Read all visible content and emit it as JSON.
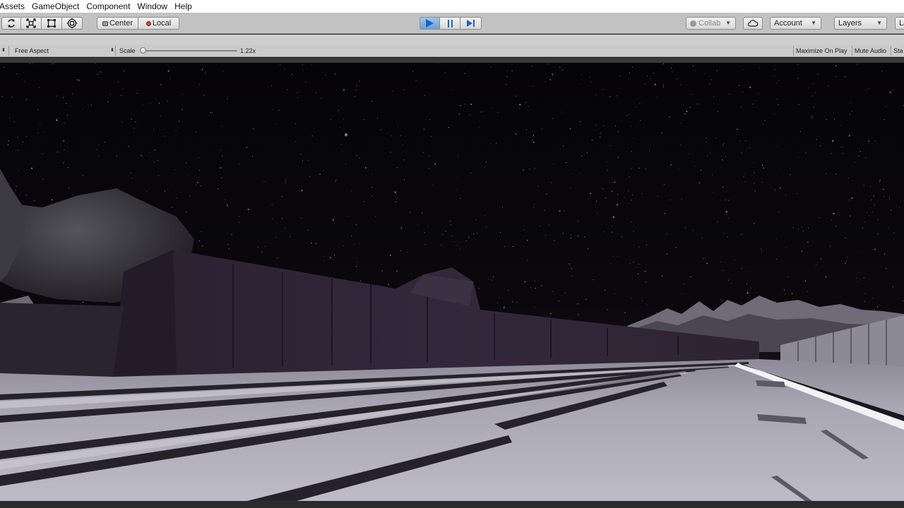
{
  "menubar": {
    "items": [
      "Assets",
      "GameObject",
      "Component",
      "Window",
      "Help"
    ]
  },
  "toolbar": {
    "pivot_center_label": "Center",
    "pivot_local_label": "Local",
    "collab_label": "Collab",
    "account_label": "Account",
    "layers_label": "Layers",
    "layout_label": "La",
    "accent_color": "#1b63c6"
  },
  "game_view": {
    "aspect_label": "Free Aspect",
    "scale_label": "Scale",
    "scale_value": "1.22x",
    "scale_fraction": 0.02,
    "maximize_label": "Maximize On Play",
    "mute_label": "Mute Audio",
    "stats_label": "Sta"
  },
  "icons": [
    "rotate-tool-icon",
    "scale-tool-icon",
    "rect-tool-icon",
    "transform-tool-icon",
    "play-icon",
    "pause-icon",
    "step-icon",
    "cloud-icon",
    "mouse-cursor-icon"
  ]
}
